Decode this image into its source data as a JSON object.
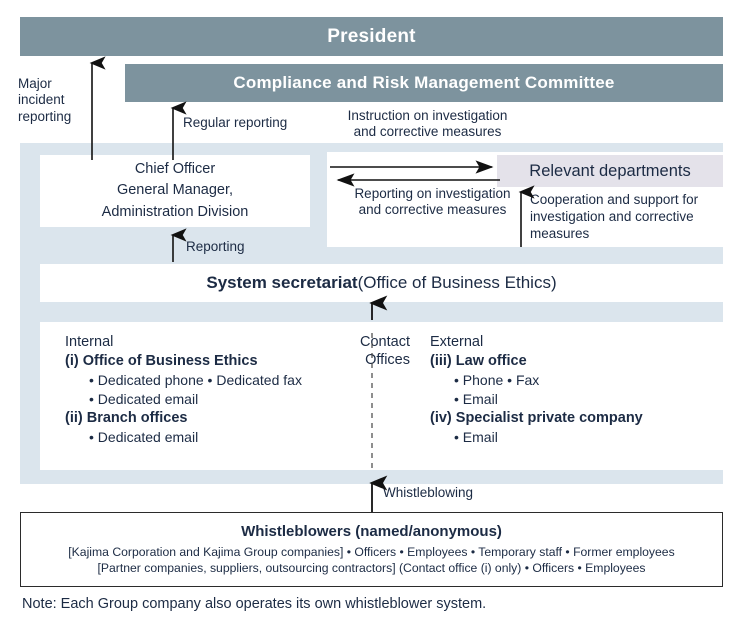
{
  "colors": {
    "header_bar": "#7d939e",
    "panel_background": "#dbe5ed",
    "relevant_departments_background": "#e4e2ea",
    "text": "#1c2b44",
    "bullet": "#8c99ab"
  },
  "header": {
    "president": "President",
    "committee": "Compliance and Risk Management Committee"
  },
  "chief_officer": {
    "line1": "Chief Officer",
    "line2": "General Manager,",
    "line3": "Administration Division"
  },
  "relevant_departments": {
    "label": "Relevant departments"
  },
  "secretariat": {
    "bold_part": "System secretariat",
    "rest_part": " (Office of Business Ethics)"
  },
  "flows": {
    "major_incident_reporting": "Major incident reporting",
    "regular_reporting": "Regular reporting",
    "instruction": "Instruction on investigation and corrective measures",
    "reporting_on": "Reporting on investigation and corrective measures",
    "cooperation": "Cooperation and support for investigation and corrective measures",
    "reporting": "Reporting",
    "whistleblowing": "Whistleblowing"
  },
  "contact_offices": {
    "label_line1": "Contact",
    "label_line2": "Offices",
    "internal": {
      "heading": "Internal",
      "groups": [
        {
          "title": "(i) Office of Business Ethics",
          "rows": [
            "• Dedicated phone   • Dedicated fax",
            "• Dedicated email"
          ]
        },
        {
          "title": "(ii) Branch offices",
          "rows": [
            "• Dedicated email"
          ]
        }
      ]
    },
    "external": {
      "heading": "External",
      "groups": [
        {
          "title": "(iii) Law office",
          "rows": [
            "• Phone   • Fax",
            "• Email"
          ]
        },
        {
          "title": "(iv) Specialist private company",
          "rows": [
            "• Email"
          ]
        }
      ]
    }
  },
  "whistleblowers": {
    "title": "Whistleblowers (named/anonymous)",
    "row1": "[Kajima Corporation and Kajima Group companies]  • Officers  • Employees  • Temporary staff  • Former employees",
    "row2": "[Partner companies, suppliers, outsourcing contractors] (Contact office (i) only)  • Officers  • Employees"
  },
  "note": "Note: Each Group company also operates its own whistleblower system."
}
